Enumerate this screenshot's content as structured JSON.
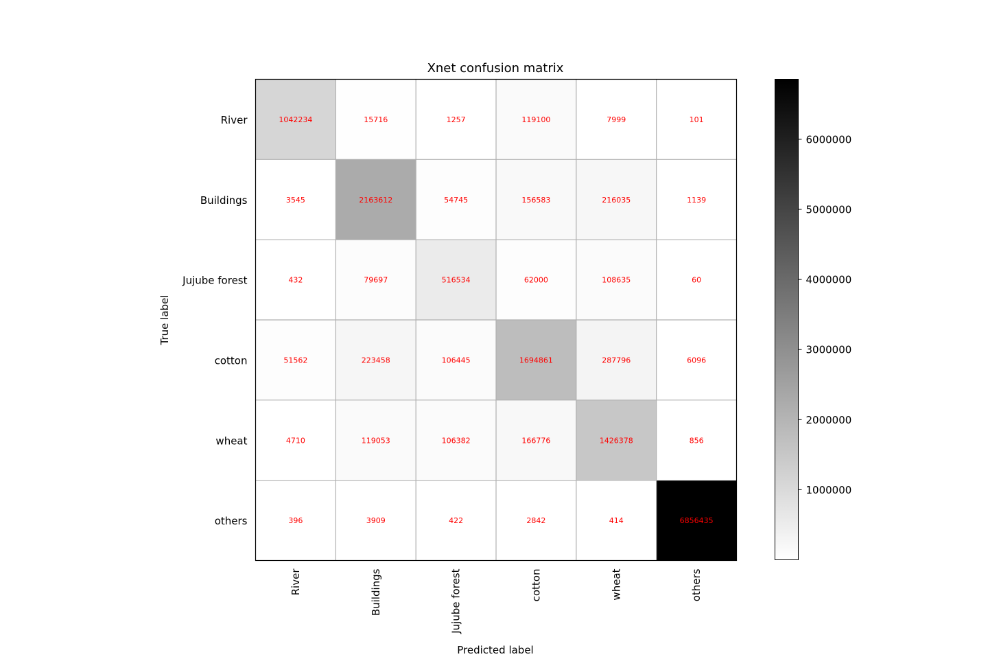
{
  "chart_data": {
    "type": "heatmap",
    "title": "Xnet confusion matrix",
    "xlabel": "Predicted label",
    "ylabel": "True label",
    "x_categories": [
      "River",
      "Buildings",
      "Jujube forest",
      "cotton",
      "wheat",
      "others"
    ],
    "y_categories": [
      "River",
      "Buildings",
      "Jujube forest",
      "cotton",
      "wheat",
      "others"
    ],
    "matrix": [
      [
        1042234,
        15716,
        1257,
        119100,
        7999,
        101
      ],
      [
        3545,
        2163612,
        54745,
        156583,
        216035,
        1139
      ],
      [
        432,
        79697,
        516534,
        62000,
        108635,
        60
      ],
      [
        51562,
        223458,
        106445,
        1694861,
        287796,
        6096
      ],
      [
        4710,
        119053,
        106382,
        166776,
        1426378,
        856
      ],
      [
        396,
        3909,
        422,
        2842,
        414,
        6856435
      ]
    ],
    "colormap": "Greys",
    "value_range": [
      60,
      6856435
    ],
    "annotation_color": "#ff0000",
    "grid": true,
    "grid_color": "#b0b0b0",
    "colorbar": {
      "position": "right",
      "ticks": [
        1000000,
        2000000,
        3000000,
        4000000,
        5000000,
        6000000
      ],
      "tick_labels": [
        "1000000",
        "2000000",
        "3000000",
        "4000000",
        "5000000",
        "6000000"
      ]
    }
  }
}
